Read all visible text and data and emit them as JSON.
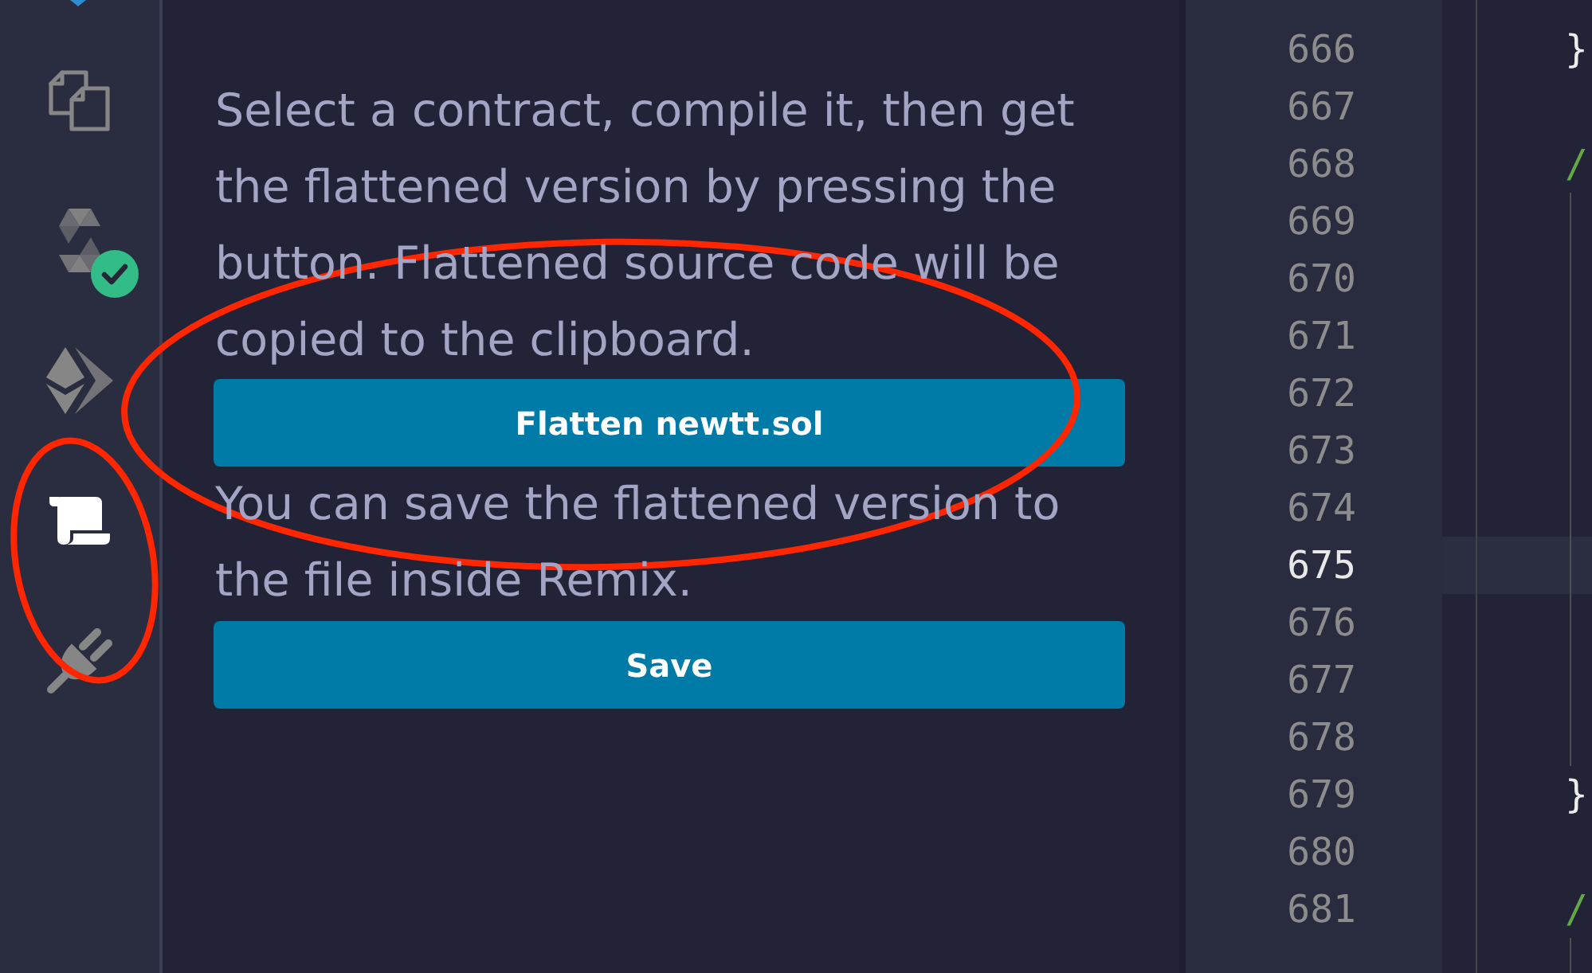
{
  "sidebar": {
    "items": [
      {
        "kind": "documents",
        "selected": false,
        "badge": false
      },
      {
        "kind": "layers",
        "selected": false,
        "badge": true
      },
      {
        "kind": "diamond",
        "selected": false,
        "badge": false
      },
      {
        "kind": "scroll",
        "selected": true,
        "badge": false
      },
      {
        "kind": "plug",
        "selected": false,
        "badge": false
      }
    ]
  },
  "panel": {
    "description": "Select a contract, compile it, then get the flattened version by pressing the button. Flattened source code will be copied to the clipboard.",
    "flatten_button": "Flatten newtt.sol",
    "save_note": "You can save the flattened version to the file inside Remix.",
    "save_button": "Save"
  },
  "editor": {
    "lines": [
      {
        "number": "666",
        "active": false,
        "guide": false,
        "code": {
          "text": "}",
          "kind": "plain"
        }
      },
      {
        "number": "667",
        "active": false,
        "guide": false
      },
      {
        "number": "668",
        "active": false,
        "guide": false,
        "code": {
          "text": "/",
          "kind": "comment"
        }
      },
      {
        "number": "669",
        "active": false,
        "guide": true
      },
      {
        "number": "670",
        "active": false,
        "guide": true
      },
      {
        "number": "671",
        "active": false,
        "guide": true
      },
      {
        "number": "672",
        "active": false,
        "guide": true
      },
      {
        "number": "673",
        "active": false,
        "guide": true
      },
      {
        "number": "674",
        "active": false,
        "guide": true
      },
      {
        "number": "675",
        "active": true,
        "guide": true
      },
      {
        "number": "676",
        "active": false,
        "guide": true
      },
      {
        "number": "677",
        "active": false,
        "guide": true
      },
      {
        "number": "678",
        "active": false,
        "guide": true
      },
      {
        "number": "679",
        "active": false,
        "guide": false,
        "code": {
          "text": "}",
          "kind": "plain"
        }
      },
      {
        "number": "680",
        "active": false,
        "guide": false
      },
      {
        "number": "681",
        "active": false,
        "guide": false,
        "code": {
          "text": "/",
          "kind": "comment"
        }
      },
      {
        "active": false,
        "guide": true
      }
    ]
  }
}
